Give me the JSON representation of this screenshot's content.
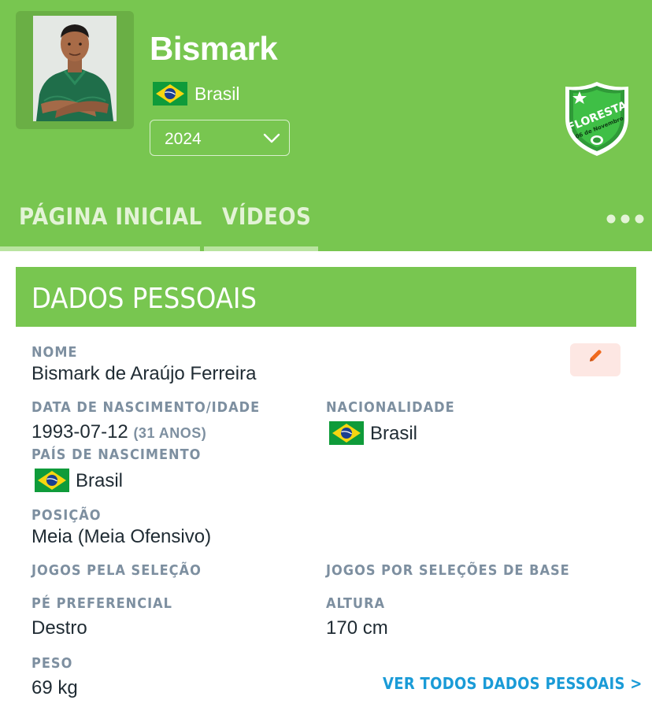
{
  "player": {
    "name": "Bismark",
    "country": "Brasil",
    "season": "2024"
  },
  "club": {
    "logo_text": "FLORESTA",
    "logo_subtext": "06 de Novembro"
  },
  "tabs": [
    {
      "label": "PÁGINA INICIAL",
      "active": true
    },
    {
      "label": "VÍDEOS",
      "active": false
    }
  ],
  "personal": {
    "section_title": "DADOS PESSOAIS",
    "name_label": "NOME",
    "name_value": "Bismark de Araújo Ferreira",
    "birth_label": "DATA DE NASCIMENTO/IDADE",
    "birth_value": "1993-07-12",
    "age_value": "(31 ANOS)",
    "nationality_label": "NACIONALIDADE",
    "nationality_value": "Brasil",
    "birth_country_label": "PAÍS DE NASCIMENTO",
    "birth_country_value": "Brasil",
    "position_label": "POSIÇÃO",
    "position_value": "Meia (Meia Ofensivo)",
    "caps_label": "JOGOS PELA SELEÇÃO",
    "youth_caps_label": "JOGOS POR SELEÇÕES DE BASE",
    "foot_label": "PÉ PREFERENCIAL",
    "foot_value": "Destro",
    "height_label": "ALTURA",
    "height_value": "170 cm",
    "weight_label": "PESO",
    "weight_value": "69 kg",
    "see_all_label": "VER TODOS DADOS PESSOAIS >"
  },
  "colors": {
    "header_green": "#78c650",
    "label_gray": "#7d8fa0",
    "link_blue": "#1a9bd7",
    "edit_orange": "#f06a1e"
  },
  "icons": [
    "brazil-flag-icon",
    "chevron-down-icon",
    "more-dots-icon",
    "pencil-icon",
    "club-crest-icon"
  ]
}
